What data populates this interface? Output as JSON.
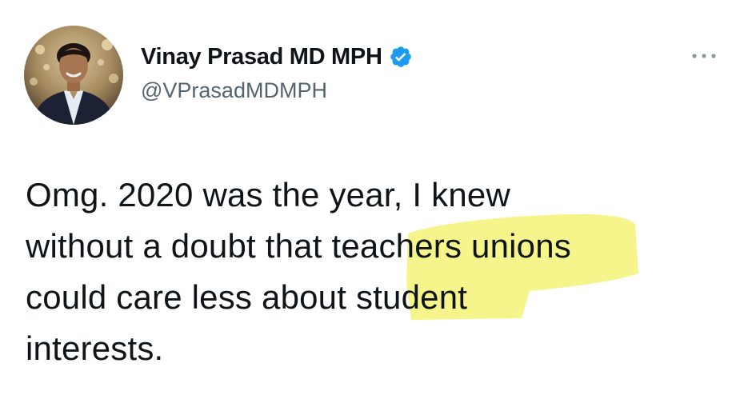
{
  "author": {
    "display_name": "Vinay Prasad MD MPH",
    "handle": "@VPrasadMDMPH",
    "verified": true,
    "avatar_icon": "profile-photo",
    "verified_icon": "verified-badge-icon",
    "verified_color": "#1d9bf0"
  },
  "tweet": {
    "lines": [
      "Omg. 2020 was the year, I knew",
      "without a doubt that teachers unions",
      "could care less about student",
      "interests."
    ]
  },
  "menu": {
    "icon": "more-options-icon"
  },
  "colors": {
    "text": "#0f1419",
    "secondary_text": "#536471",
    "highlight": "#f2f26a"
  }
}
